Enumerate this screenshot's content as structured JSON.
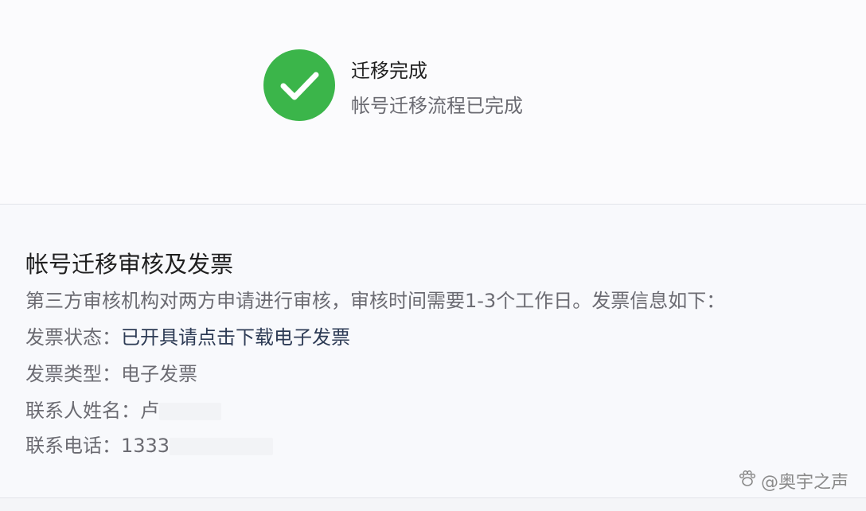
{
  "status": {
    "title": "迁移完成",
    "subtitle": "帐号迁移流程已完成",
    "success_color": "#3bb54a"
  },
  "details": {
    "title": "帐号迁移审核及发票",
    "description": "第三方审核机构对两方申请进行审核，审核时间需要1-3个工作日。发票信息如下：",
    "invoice_status_label": "发票状态：",
    "invoice_status_value": "已开具请点击下载电子发票",
    "invoice_type_label": "发票类型：",
    "invoice_type_value": "电子发票",
    "contact_name_label": "联系人姓名：",
    "contact_name_value": "卢",
    "contact_phone_label": "联系电话：",
    "contact_phone_value": "1333"
  },
  "watermark": {
    "icon": "paw-icon",
    "text": "@奥宇之声"
  }
}
